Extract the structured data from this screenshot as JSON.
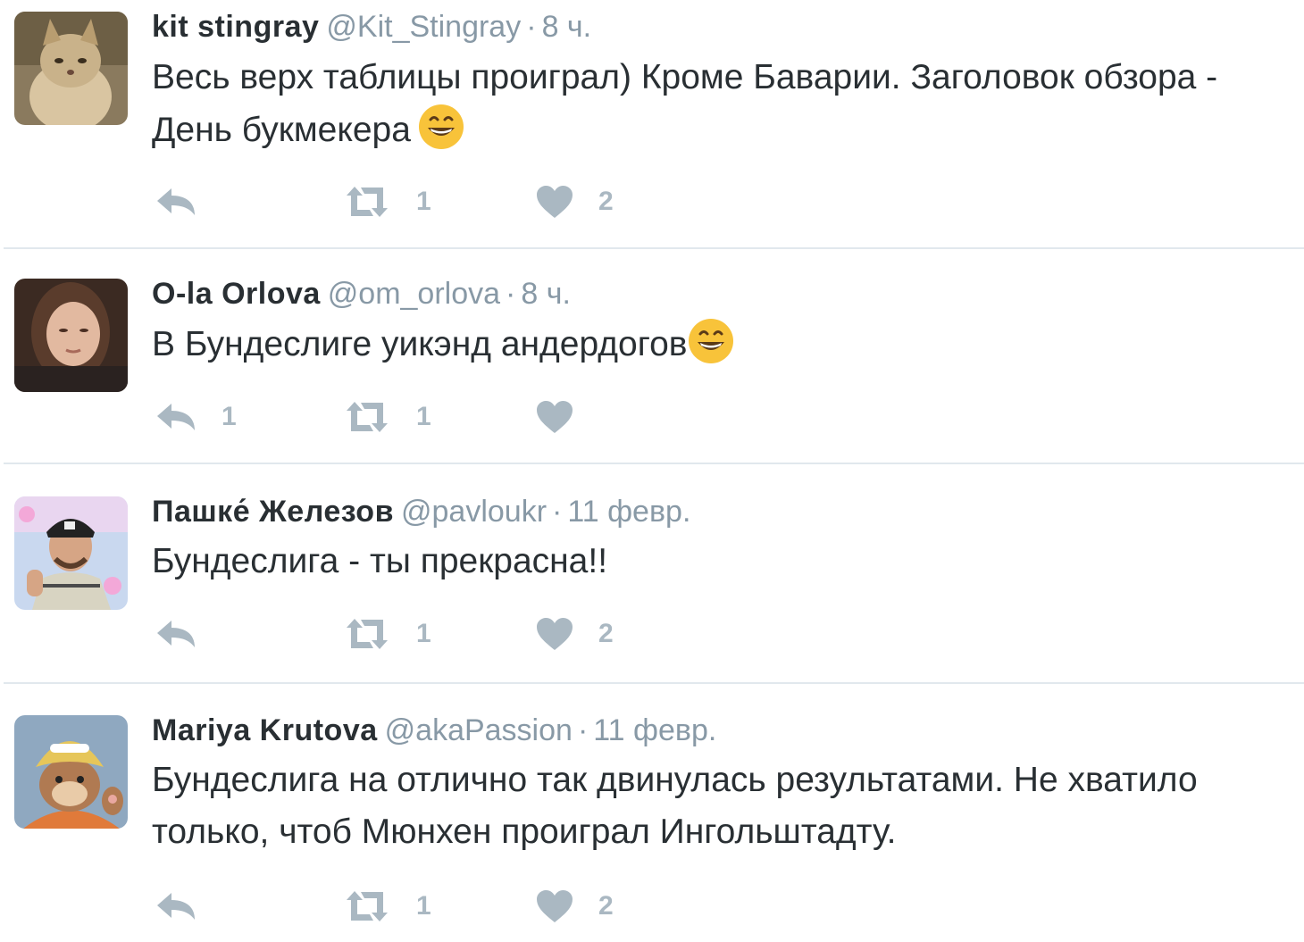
{
  "tweets": [
    {
      "name": "kit stingray",
      "handle": "@Kit_Stingray",
      "separator": "·",
      "time": "8 ч.",
      "text": "Весь верх таблицы проиграл) Кроме Баварии. Заголовок обзора - День букмекера",
      "emoji": "grinning-face",
      "replies": "",
      "retweets": "1",
      "likes": "2"
    },
    {
      "name": "O-la Orlova",
      "handle": "@om_orlova",
      "separator": "·",
      "time": "8 ч.",
      "text": "В Бундеслиге уикэнд андердогов",
      "emoji": "grinning-face",
      "replies": "1",
      "retweets": "1",
      "likes": ""
    },
    {
      "name": "Пашке́ Железов",
      "handle": "@pavloukr",
      "separator": "·",
      "time": "11 февр.",
      "text": "Бундеслига - ты прекрасна!!",
      "replies": "",
      "retweets": "1",
      "likes": "2"
    },
    {
      "name": "Mariya Krutova",
      "handle": "@akaPassion",
      "separator": "·",
      "time": "11 февр.",
      "text": "Бундеслига на отлично так двинулась результатами. Не хватило только, чтоб Мюнхен проиграл Ингольштадту.",
      "replies": "",
      "retweets": "1",
      "likes": "2"
    }
  ],
  "icons": {
    "reply": "reply-icon",
    "retweet": "retweet-icon",
    "like": "heart-icon",
    "emoji": "grinning-face-emoji"
  },
  "colors": {
    "text": "#292f33",
    "meta": "#8899a6",
    "action": "#aab8c2",
    "divider": "#e1e8ed",
    "emoji": "#f8c33a"
  }
}
